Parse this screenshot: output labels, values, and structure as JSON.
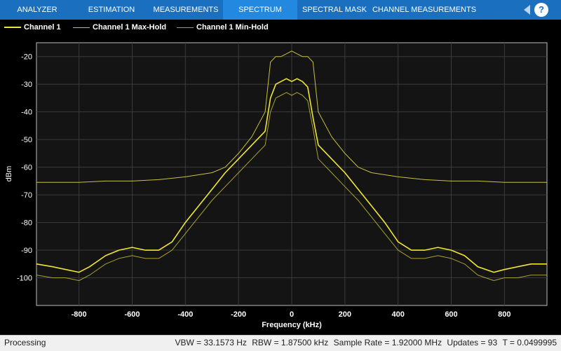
{
  "toolstrip": {
    "tabs": [
      "ANALYZER",
      "ESTIMATION",
      "MEASUREMENTS",
      "SPECTRUM",
      "SPECTRAL MASK",
      "CHANNEL MEASUREMENTS"
    ],
    "active_tab": "SPECTRUM",
    "help_label": "?"
  },
  "legend": {
    "entries": [
      {
        "label": "Channel 1",
        "color": "#f0e632"
      },
      {
        "label": "Channel 1 Max-Hold",
        "color": "#c8c040"
      },
      {
        "label": "Channel 1 Min-Hold",
        "color": "#a8a030"
      }
    ]
  },
  "status": {
    "left": "Processing",
    "vbw": "VBW = 33.1573 Hz",
    "rbw": "RBW = 1.87500 kHz",
    "sample_rate": "Sample Rate = 1.92000 MHz",
    "updates": "Updates = 93",
    "time": "T = 0.0499995"
  },
  "chart_data": {
    "type": "line",
    "xlabel": "Frequency (kHz)",
    "ylabel": "dBm",
    "xlim": [
      -960,
      960
    ],
    "ylim": [
      -110,
      -15
    ],
    "xticks": [
      -800,
      -600,
      -400,
      -200,
      0,
      200,
      400,
      600,
      800
    ],
    "yticks": [
      -20,
      -30,
      -40,
      -50,
      -60,
      -70,
      -80,
      -90,
      -100
    ],
    "grid": true,
    "legend_position": "top-left",
    "series": [
      {
        "name": "Channel 1",
        "color": "#f0e632",
        "x": [
          -960,
          -900,
          -850,
          -800,
          -760,
          -700,
          -650,
          -600,
          -550,
          -500,
          -450,
          -400,
          -350,
          -300,
          -250,
          -200,
          -150,
          -100,
          -80,
          -60,
          -40,
          -20,
          0,
          20,
          40,
          60,
          80,
          100,
          150,
          200,
          250,
          300,
          350,
          400,
          450,
          500,
          550,
          600,
          650,
          700,
          760,
          800,
          850,
          900,
          960
        ],
        "y": [
          -95,
          -96,
          -97,
          -98,
          -96,
          -92,
          -90,
          -89,
          -90,
          -90,
          -87,
          -80,
          -74,
          -68,
          -62,
          -57,
          -52,
          -47,
          -35,
          -30,
          -29,
          -28,
          -29,
          -28,
          -29,
          -31,
          -42,
          -52,
          -57,
          -62,
          -68,
          -74,
          -80,
          -87,
          -90,
          -90,
          -89,
          -90,
          -92,
          -96,
          -98,
          -97,
          -96,
          -95,
          -95
        ]
      },
      {
        "name": "Channel 1 Max-Hold",
        "color": "#c8c040",
        "x": [
          -960,
          -900,
          -800,
          -700,
          -600,
          -500,
          -400,
          -300,
          -250,
          -200,
          -150,
          -100,
          -80,
          -60,
          -40,
          -20,
          0,
          20,
          40,
          60,
          80,
          100,
          150,
          200,
          250,
          300,
          400,
          500,
          600,
          700,
          800,
          900,
          960
        ],
        "y": [
          -65.5,
          -65.5,
          -65.5,
          -65,
          -65,
          -64.5,
          -63.5,
          -62,
          -60,
          -55,
          -49,
          -40,
          -22,
          -20,
          -20,
          -19,
          -18,
          -19,
          -20,
          -20,
          -22,
          -40,
          -49,
          -55,
          -60,
          -62,
          -63.5,
          -64.5,
          -65,
          -65,
          -65.5,
          -65.5,
          -65.5
        ]
      },
      {
        "name": "Channel 1 Min-Hold",
        "color": "#a8a030",
        "x": [
          -960,
          -900,
          -850,
          -800,
          -760,
          -700,
          -650,
          -600,
          -550,
          -500,
          -450,
          -400,
          -350,
          -300,
          -250,
          -200,
          -150,
          -100,
          -80,
          -60,
          -40,
          -20,
          0,
          20,
          40,
          60,
          80,
          100,
          150,
          200,
          250,
          300,
          350,
          400,
          450,
          500,
          550,
          600,
          650,
          700,
          760,
          800,
          850,
          900,
          960
        ],
        "y": [
          -99,
          -100,
          -100,
          -101,
          -99,
          -95,
          -93,
          -92,
          -93,
          -93,
          -90,
          -84,
          -78,
          -72,
          -67,
          -62,
          -57,
          -52,
          -40,
          -35,
          -34,
          -33,
          -34,
          -33,
          -34,
          -36,
          -46,
          -57,
          -62,
          -67,
          -72,
          -78,
          -84,
          -90,
          -93,
          -93,
          -92,
          -93,
          -95,
          -99,
          -101,
          -100,
          -100,
          -99,
          -99
        ]
      }
    ]
  }
}
